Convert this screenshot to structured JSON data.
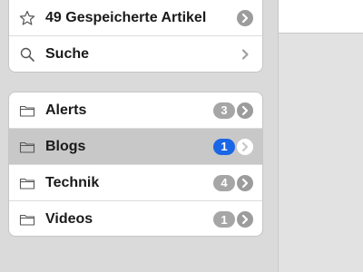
{
  "saved": {
    "label": "49 Gespeicherte Artikel"
  },
  "search": {
    "label": "Suche"
  },
  "folders": [
    {
      "label": "Alerts",
      "count": "3"
    },
    {
      "label": "Blogs",
      "count": "1"
    },
    {
      "label": "Technik",
      "count": "4"
    },
    {
      "label": "Videos",
      "count": "1"
    }
  ],
  "colors": {
    "badge_default": "#a6a6a6",
    "badge_unread": "#1a66e6",
    "selected_row": "#c8c8c8"
  },
  "icons": {
    "saved": "star-outline-icon",
    "search": "magnifier-icon",
    "folder": "folder-icon",
    "disclosure": "chevron-right-icon"
  }
}
